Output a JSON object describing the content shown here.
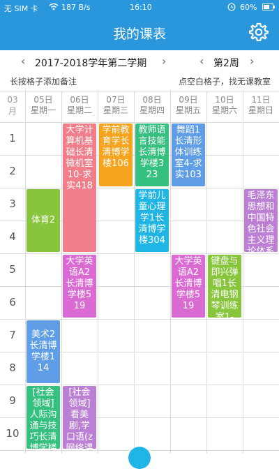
{
  "status_bar": {
    "carrier": "无 SIM 卡",
    "speed": "187 B/s",
    "time": "16:10",
    "battery": "60%"
  },
  "header": {
    "title": "我的课表",
    "settings_icon": "gear-icon"
  },
  "nav": {
    "term": "2017-2018学年第二学期",
    "week": "第2周",
    "prev_icon": "chevron-left-icon",
    "next_icon": "chevron-right-icon"
  },
  "hints": {
    "left": "长按格子添加备注",
    "right": "点空白格子，找无课教室"
  },
  "calendar": {
    "month_num": "03",
    "month_unit": "月",
    "days": [
      {
        "date": "05日",
        "weekday": "星期一"
      },
      {
        "date": "06日",
        "weekday": "星期二"
      },
      {
        "date": "07日",
        "weekday": "星期三"
      },
      {
        "date": "08日",
        "weekday": "星期四"
      },
      {
        "date": "09日",
        "weekday": "星期五"
      },
      {
        "date": "10日",
        "weekday": "星期六"
      },
      {
        "date": "11日",
        "weekday": "星期日"
      }
    ],
    "periods": [
      "1",
      "2",
      "3",
      "4",
      "5",
      "6",
      "7",
      "8",
      "9",
      "10"
    ]
  },
  "courses": [
    {
      "day": 1,
      "start": 1,
      "end": 4,
      "text": "大学计算机基础长清微机室10-求实418",
      "color": "#f07f8b"
    },
    {
      "day": 2,
      "start": 1,
      "end": 2,
      "text": "学前教育学长清博学楼106",
      "color": "#f6a31d"
    },
    {
      "day": 3,
      "start": 1,
      "end": 2,
      "text": "教师语言技能长清博学楼323",
      "color": "#35c080"
    },
    {
      "day": 4,
      "start": 1,
      "end": 2,
      "text": "舞蹈1长清形体训练室4-求实103",
      "color": "#5f9ee6"
    },
    {
      "day": 0,
      "start": 3,
      "end": 4,
      "text": "体育2",
      "color": "#86c53c"
    },
    {
      "day": 3,
      "start": 3,
      "end": 4,
      "text": "学前儿童心理学1长清博学楼304",
      "color": "#1fb6e6"
    },
    {
      "day": 6,
      "start": 3,
      "end": 4,
      "text": "毛泽东思想和中国特色社会主义理论体系",
      "color": "#bb7fd4"
    },
    {
      "day": 1,
      "start": 5,
      "end": 6,
      "text": "大学英语A2长清博学楼519",
      "color": "#d96bd2"
    },
    {
      "day": 4,
      "start": 5,
      "end": 6,
      "text": "大学英语A2长清博学楼519",
      "color": "#d96bd2"
    },
    {
      "day": 5,
      "start": 5,
      "end": 6,
      "text": "键盘与即兴弹唱1长清电钢琴训练室1-",
      "color": "#86c53c"
    },
    {
      "day": 0,
      "start": 7,
      "end": 8,
      "text": "美术2长清博学楼114",
      "color": "#5f9ee6"
    },
    {
      "day": 0,
      "start": 9,
      "end": 10,
      "text": "[社会领域]人际沟通与技巧长清博学楼文楼",
      "color": "#35c080"
    },
    {
      "day": 1,
      "start": 9,
      "end": 10,
      "text": "[社会领域]看美剧,学口语(z网络课程)",
      "color": "#bb7fd4"
    }
  ]
}
